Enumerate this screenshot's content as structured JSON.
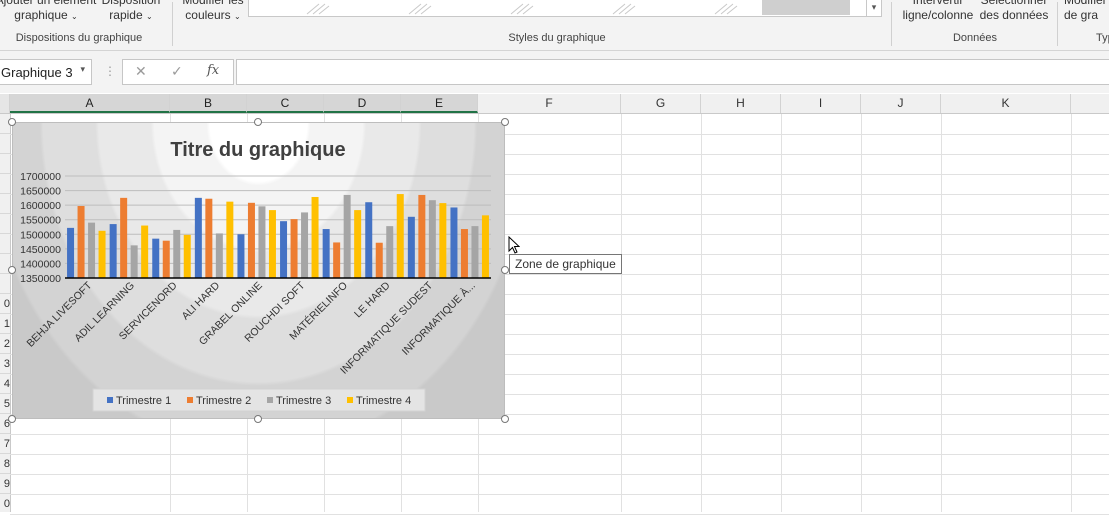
{
  "ribbon": {
    "add_element": {
      "line1": "Ajouter un élément",
      "line2": "graphique"
    },
    "quick_layout": {
      "line1": "Disposition",
      "line2": "rapide"
    },
    "change_colors": {
      "line1": "Modifier les",
      "line2": "couleurs"
    },
    "switch_row_col": {
      "line1": "Intervertir",
      "line2": "ligne/colonne"
    },
    "select_data": {
      "line1": "Sélectionner",
      "line2": "des données"
    },
    "change_type": {
      "line1": "Modifier",
      "line2": "de gra"
    },
    "groups": {
      "layouts": "Dispositions du graphique",
      "styles": "Styles du graphique",
      "data": "Données",
      "type": "Typ"
    }
  },
  "formula_bar": {
    "name_box": "Graphique 3",
    "name_box_caret": "▾",
    "dots": "⋮",
    "cancel_glyph": "✕",
    "enter_glyph": "✓",
    "fx": "fx",
    "value": ""
  },
  "columns": [
    "A",
    "B",
    "C",
    "D",
    "E",
    "F",
    "G",
    "H",
    "I",
    "J",
    "K"
  ],
  "rows": [
    "",
    "",
    "",
    "",
    "",
    "",
    "",
    "",
    "",
    "0",
    "1",
    "2",
    "3",
    "4",
    "5",
    "6",
    "7",
    "8",
    "9",
    "0"
  ],
  "chart_data": {
    "type": "bar",
    "title": "Titre du graphique",
    "categories": [
      "BEHJA LIVESOFT",
      "ADIL LEARNING",
      "SERVICENORD",
      "ALI HARD",
      "GRABEL ONLINE",
      "ROUCHDI SOFT",
      "MATÉRIELINFO",
      "LE HARD",
      "INFORMATIQUE SUDEST",
      "INFORMATIQUE À..."
    ],
    "series": [
      {
        "name": "Trimestre 1",
        "color": "#4472C4",
        "values": [
          1522000,
          1535000,
          1485000,
          1625000,
          1500000,
          1545000,
          1518000,
          1610000,
          1560000,
          1592000
        ]
      },
      {
        "name": "Trimestre 2",
        "color": "#ED7D31",
        "values": [
          1597000,
          1625000,
          1478000,
          1622000,
          1608000,
          1552000,
          1472000,
          1471000,
          1635000,
          1518000
        ]
      },
      {
        "name": "Trimestre 3",
        "color": "#A5A5A5",
        "values": [
          1540000,
          1462000,
          1515000,
          1503000,
          1596000,
          1575000,
          1635000,
          1528000,
          1617000,
          1528000
        ]
      },
      {
        "name": "Trimestre 4",
        "color": "#FFC000",
        "values": [
          1512000,
          1530000,
          1498000,
          1612000,
          1583000,
          1628000,
          1583000,
          1638000,
          1607000,
          1565000
        ]
      }
    ],
    "yticks": [
      "1700000",
      "1650000",
      "1600000",
      "1550000",
      "1500000",
      "1450000",
      "1400000",
      "1350000"
    ],
    "ylim": [
      1350000,
      1700000
    ],
    "grid": true,
    "legend_position": "bottom"
  },
  "tooltip": "Zone de graphique"
}
